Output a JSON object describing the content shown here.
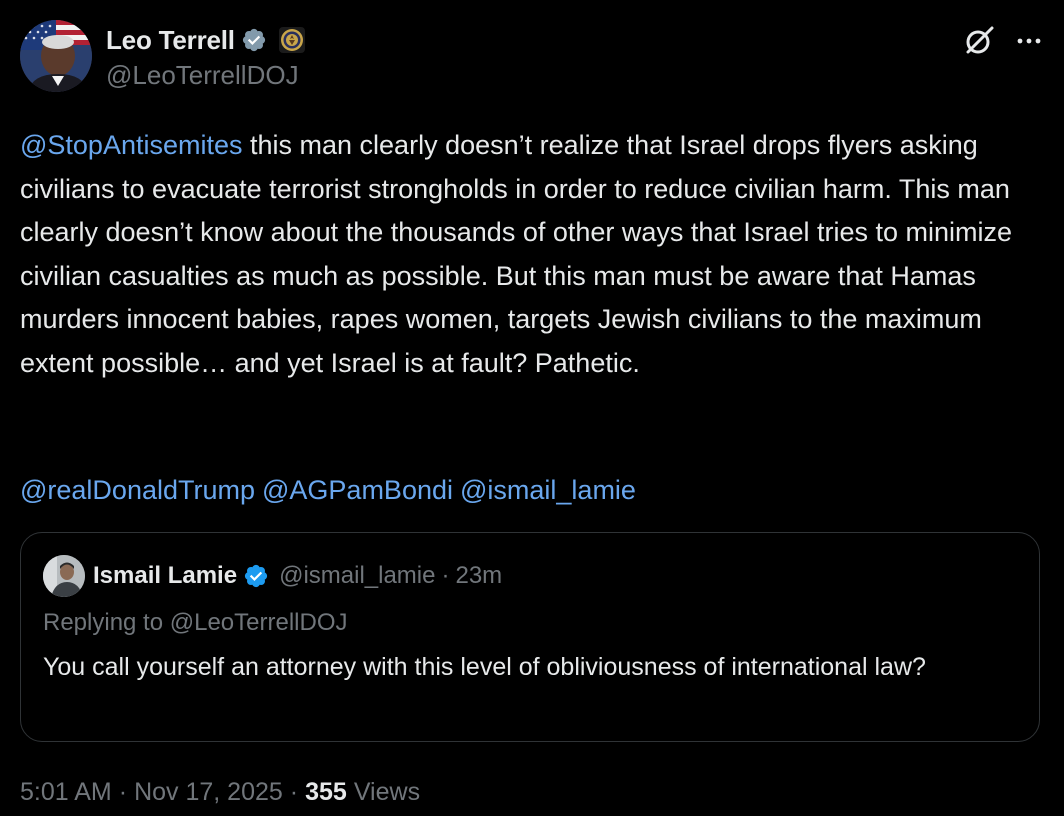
{
  "author": {
    "display_name": "Leo Terrell",
    "handle": "@LeoTerrellDOJ",
    "verified_color": "#1d9bf0"
  },
  "icons": {
    "avatar": "profile-photo",
    "verified": "verified-badge-icon",
    "affiliation": "doj-seal-icon",
    "grok": "grok-icon",
    "more": "more-icon"
  },
  "post": {
    "mention": "@StopAntisemites",
    "text": " this man clearly doesn’t realize that Israel drops flyers asking civilians to evacuate terrorist strongholds in order to reduce civilian harm. This man clearly doesn’t know about the thousands of other ways that Israel tries to minimize civilian casualties as much as possible. But this man must be aware that Hamas murders innocent babies, rapes women, targets Jewish civilians to the maximum extent possible… and yet Israel is at fault? Pathetic.",
    "mentions": [
      "@realDonaldTrump",
      "@AGPamBondi",
      "@ismail_lamie"
    ]
  },
  "quote": {
    "display_name": "Ismail Lamie",
    "handle": "@ismail_lamie",
    "separator": "·",
    "time": "23m",
    "replying_to": "Replying to @LeoTerrellDOJ",
    "text": "You call yourself an attorney with this level of obliviousness of international law?"
  },
  "meta": {
    "time": "5:01 AM",
    "separator": "·",
    "date": "Nov 17, 2025",
    "views_count": "355",
    "views_label": "Views"
  },
  "colors": {
    "background": "#000000",
    "text": "#e7e9ea",
    "muted": "#71767b",
    "link": "#6aa7ee",
    "border": "#2f3336"
  }
}
